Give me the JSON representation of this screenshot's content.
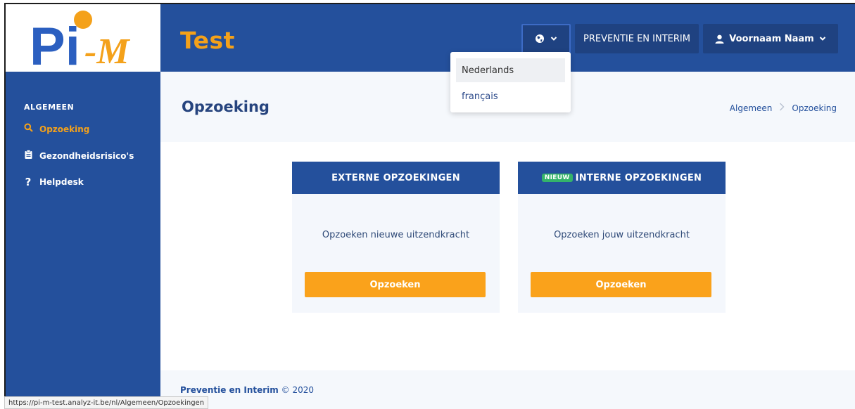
{
  "colors": {
    "brand_blue": "#24509c",
    "accent_orange": "#f4a11a",
    "button_orange": "#faa21b",
    "badge_green": "#34b36a"
  },
  "logo": {
    "text_pi": "Pi",
    "text_m": "-M"
  },
  "header": {
    "app_title": "Test",
    "language_button": {
      "icon": "globe-icon",
      "chevron": "chevron-down-icon"
    },
    "org_label": "PREVENTIE EN INTERIM",
    "user_label": "Voornaam Naam"
  },
  "language_menu": {
    "items": [
      {
        "label": "Nederlands"
      },
      {
        "label": "français"
      }
    ]
  },
  "sidebar": {
    "heading": "ALGEMEEN",
    "items": [
      {
        "label": "Opzoeking",
        "icon": "search-icon"
      },
      {
        "label": "Gezondheidsrisico's",
        "icon": "clipboard-icon"
      },
      {
        "label": "Helpdesk",
        "icon": "question-icon"
      }
    ]
  },
  "page": {
    "title": "Opzoeking",
    "breadcrumb": [
      "Algemeen",
      "Opzoeking"
    ]
  },
  "cards": [
    {
      "title": "EXTERNE OPZOEKINGEN",
      "badge": "",
      "text": "Opzoeken nieuwe uitzendkracht",
      "button": "Opzoeken"
    },
    {
      "title": "INTERNE OPZOEKINGEN",
      "badge": "NIEUW",
      "text": "Opzoeken jouw uitzendkracht",
      "button": "Opzoeken"
    }
  ],
  "footer": {
    "org": "Preventie en Interim",
    "copyright": "© 2020"
  },
  "status_url": "https://pi-m-test.analyz-it.be/nl/Algemeen/Opzoekingen"
}
